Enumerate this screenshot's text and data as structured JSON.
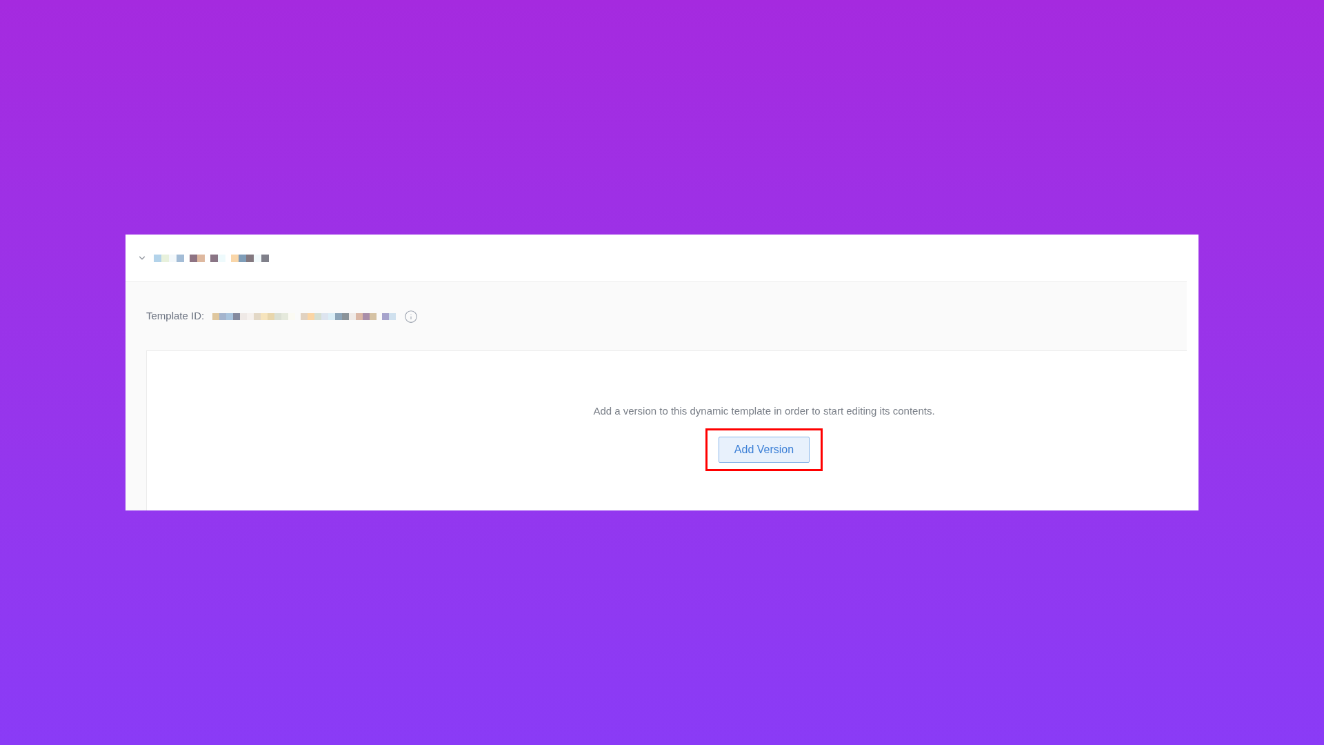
{
  "template": {
    "expanded": true,
    "id_label": "Template ID:"
  },
  "empty_state": {
    "message": "Add a version to this dynamic template in order to start editing its contents.",
    "button": {
      "label": "Add Version",
      "highlighted": true
    }
  }
}
